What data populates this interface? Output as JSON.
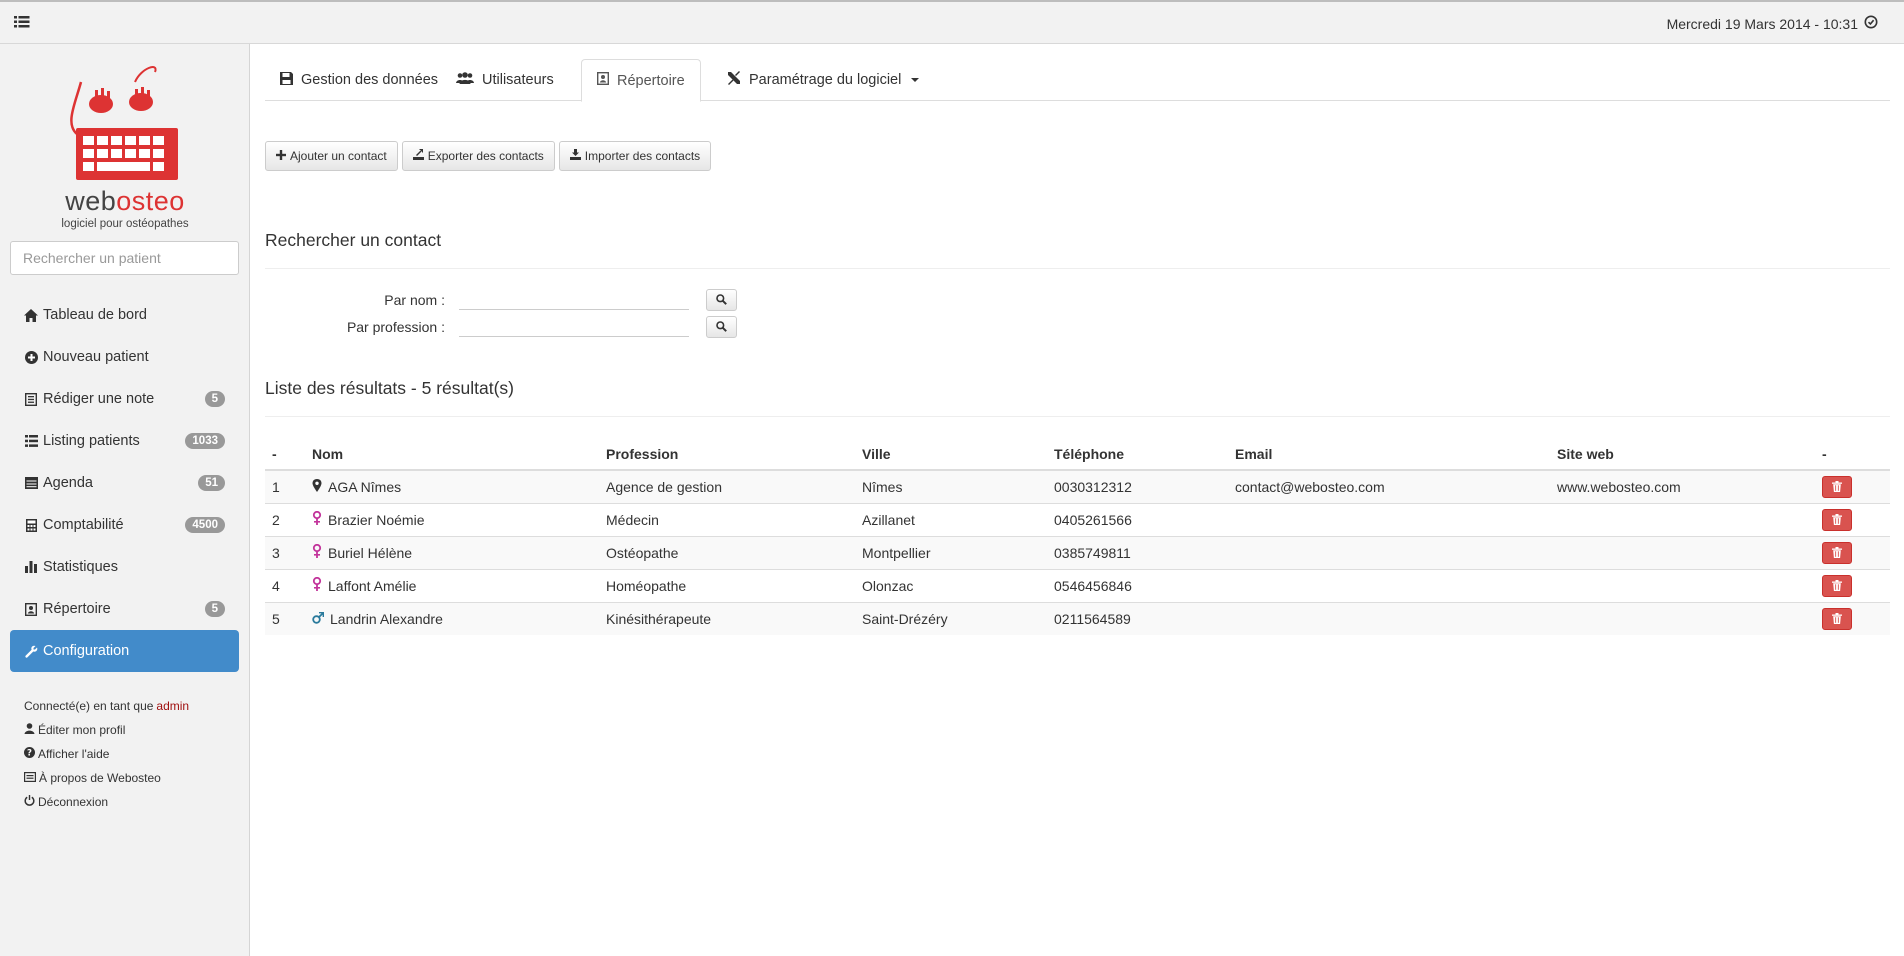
{
  "topbar": {
    "menu_icon": "list-icon",
    "datetime": "Mercredi 19 Mars 2014 - 10:31",
    "clock_icon": "clock-icon"
  },
  "sidebar": {
    "logo": {
      "text_dark": "web",
      "text_red": "osteo",
      "subtitle": "logiciel pour ostéopathes"
    },
    "search_placeholder": "Rechercher un patient",
    "items": [
      {
        "label": "Tableau de bord",
        "icon": "home-icon",
        "badge": null
      },
      {
        "label": "Nouveau patient",
        "icon": "plus-circle-icon",
        "badge": null
      },
      {
        "label": "Rédiger une note",
        "icon": "note-icon",
        "badge": "5"
      },
      {
        "label": "Listing patients",
        "icon": "list-icon",
        "badge": "1033"
      },
      {
        "label": "Agenda",
        "icon": "calendar-icon",
        "badge": "51"
      },
      {
        "label": "Comptabilité",
        "icon": "calculator-icon",
        "badge": "4500"
      },
      {
        "label": "Statistiques",
        "icon": "bar-chart-icon",
        "badge": null
      },
      {
        "label": "Répertoire",
        "icon": "address-book-icon",
        "badge": "5"
      },
      {
        "label": "Configuration",
        "icon": "wrench-icon",
        "badge": null,
        "active": true
      }
    ],
    "user": {
      "connected_prefix": "Connecté(e) en tant que",
      "username": "admin",
      "links": [
        {
          "label": "Éditer mon profil",
          "icon": "user-icon"
        },
        {
          "label": "Afficher l'aide",
          "icon": "question-icon"
        },
        {
          "label": "À propos de Webosteo",
          "icon": "info-card-icon"
        },
        {
          "label": "Déconnexion",
          "icon": "power-icon"
        }
      ]
    }
  },
  "tabs": [
    {
      "label": "Gestion des données",
      "icon": "floppy-icon"
    },
    {
      "label": "Utilisateurs",
      "icon": "users-icon"
    },
    {
      "label": "Répertoire",
      "icon": "address-book-icon",
      "active": true
    },
    {
      "label": "Paramétrage du logiciel",
      "icon": "tools-icon",
      "dropdown": true
    }
  ],
  "actions": {
    "add": "Ajouter un contact",
    "export": "Exporter des contacts",
    "import": "Importer des contacts"
  },
  "search": {
    "title": "Rechercher un contact",
    "by_name_label": "Par nom :",
    "by_profession_label": "Par profession :",
    "by_name_value": "",
    "by_profession_value": ""
  },
  "results": {
    "title": "Liste des résultats - 5 résultat(s)",
    "columns": [
      "-",
      "Nom",
      "Profession",
      "Ville",
      "Téléphone",
      "Email",
      "Site web",
      "-"
    ],
    "rows": [
      {
        "num": "1",
        "type": "place",
        "name": "AGA Nîmes",
        "profession": "Agence de gestion",
        "city": "Nîmes",
        "phone": "0030312312",
        "email": "contact@webosteo.com",
        "site": "www.webosteo.com"
      },
      {
        "num": "2",
        "type": "female",
        "name": "Brazier Noémie",
        "profession": "Médecin",
        "city": "Azillanet",
        "phone": "0405261566",
        "email": "",
        "site": ""
      },
      {
        "num": "3",
        "type": "female",
        "name": "Buriel Hélène",
        "profession": "Ostéopathe",
        "city": "Montpellier",
        "phone": "0385749811",
        "email": "",
        "site": ""
      },
      {
        "num": "4",
        "type": "female",
        "name": "Laffont Amélie",
        "profession": "Homéopathe",
        "city": "Olonzac",
        "phone": "0546456846",
        "email": "",
        "site": ""
      },
      {
        "num": "5",
        "type": "male",
        "name": "Landrin Alexandre",
        "profession": "Kinésithérapeute",
        "city": "Saint-Drézéry",
        "phone": "0211564589",
        "email": "",
        "site": ""
      }
    ]
  },
  "colors": {
    "accent": "#428bca",
    "brand_red": "#d33333",
    "danger": "#d9534f",
    "female": "#c2349b",
    "male": "#2a7a9c"
  }
}
